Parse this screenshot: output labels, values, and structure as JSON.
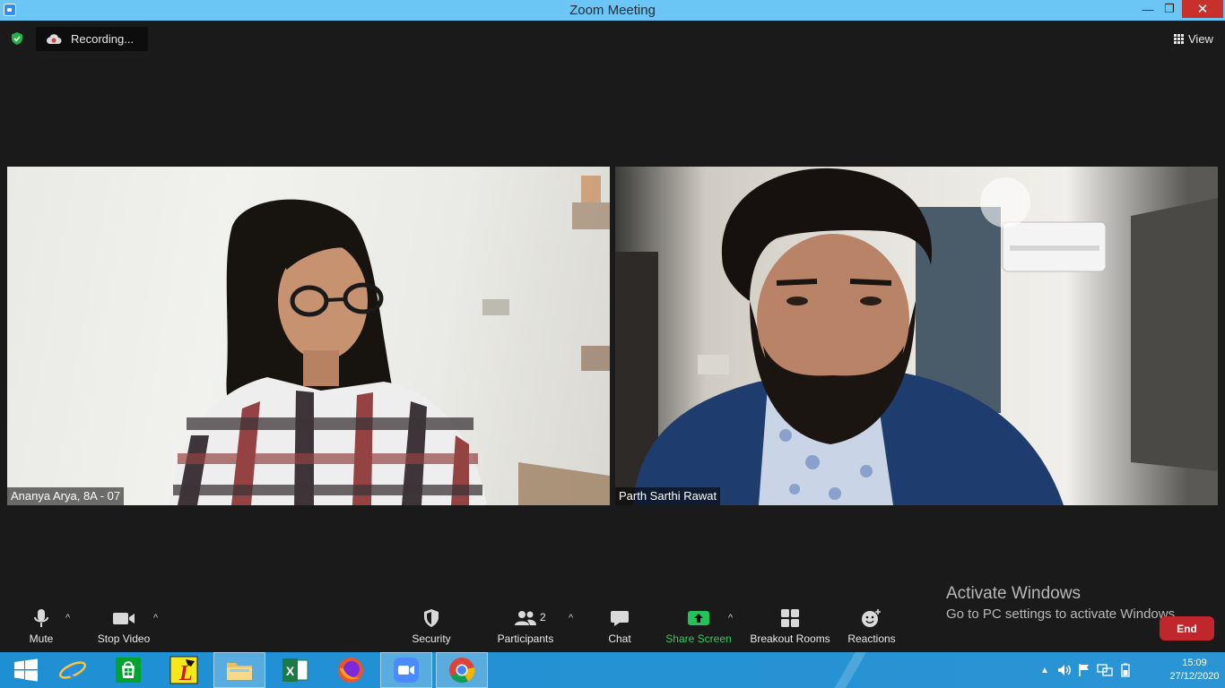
{
  "window": {
    "title": "Zoom Meeting",
    "minimize_glyph": "—",
    "maximize_glyph": "❐",
    "close_glyph": "✕"
  },
  "top_bar": {
    "recording_label": "Recording...",
    "view_label": "View"
  },
  "participants_tiles": [
    {
      "name": "Ananya Arya, 8A - 07"
    },
    {
      "name": "Parth Sarthi Rawat"
    }
  ],
  "toolbar": {
    "mute_label": "Mute",
    "stop_video_label": "Stop Video",
    "security_label": "Security",
    "participants_label": "Participants",
    "participants_count": "2",
    "chat_label": "Chat",
    "share_screen_label": "Share Screen",
    "breakout_rooms_label": "Breakout Rooms",
    "reactions_label": "Reactions",
    "end_label": "End",
    "caret_glyph": "^"
  },
  "watermark": {
    "line1": "Activate Windows",
    "line2": "Go to PC settings to activate Windows."
  },
  "taskbar": {
    "apps": [
      "windows-start",
      "internet-explorer",
      "microsoft-store",
      "lingo-app",
      "file-explorer",
      "excel",
      "firefox",
      "zoom",
      "chrome"
    ],
    "clock_time": "15:09",
    "clock_date": "27/12/2020"
  },
  "colors": {
    "titlebar": "#6cc6f5",
    "meeting_bg": "#1a1a1a",
    "share_green": "#21c35a",
    "end_red": "#c0272d",
    "taskbar_blue": "#2592d3"
  }
}
